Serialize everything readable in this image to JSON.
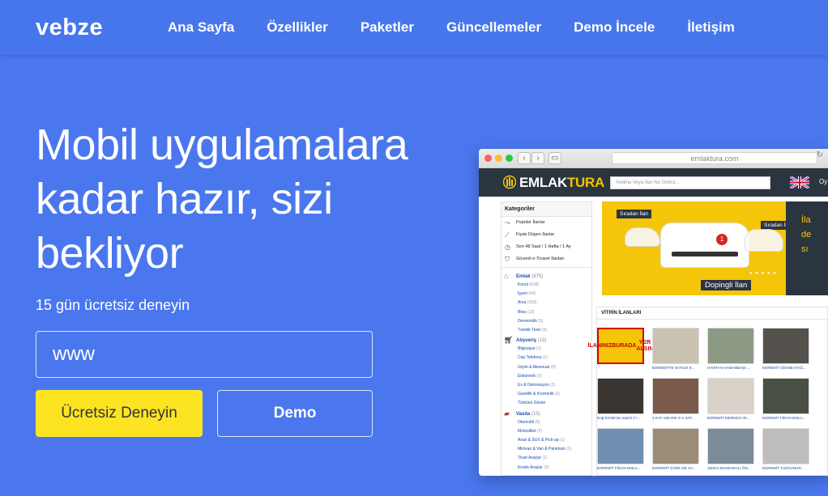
{
  "header": {
    "logo": "vebze",
    "nav": [
      "Ana Sayfa",
      "Özellikler",
      "Paketler",
      "Güncellemeler",
      "Demo İncele",
      "İletişim"
    ]
  },
  "hero": {
    "title": "Mobil uygulamalara kadar hazır, sizi bekliyor",
    "subtitle": "15 gün ücretsiz deneyin",
    "domain_placeholder": "www",
    "trial_button": "Ücretsiz Deneyin",
    "demo_button": "Demo"
  },
  "browser": {
    "url": "emlaktura.com",
    "site": {
      "logo_prefix": "EMLAK",
      "logo_accent": "TURA",
      "search_placeholder": "Kelime Veya İlan No Giriniz...",
      "lang": "Oy"
    },
    "sidebar": {
      "title": "Kategoriler",
      "quick": [
        "Popüler İlanlar",
        "Fiyatı Düşen İlanlar",
        "Son 48 Saat  / 1 Hafta / 1 Ay",
        "Güvenli e-Ticaret İlanları"
      ],
      "categories": [
        {
          "name": "Emlak",
          "count": "(975)",
          "items": [
            {
              "name": "Konut",
              "count": "(638)"
            },
            {
              "name": "İşyeri",
              "count": "(64)"
            },
            {
              "name": "Arsa",
              "count": "(250)"
            },
            {
              "name": "Bina",
              "count": "(13)"
            },
            {
              "name": "Devremülk",
              "count": "(5)"
            },
            {
              "name": "Turistik Tesis",
              "count": "(5)"
            }
          ]
        },
        {
          "name": "Alışveriş",
          "count": "(13)",
          "items": [
            {
              "name": "Bilgisayar",
              "count": "(1)"
            },
            {
              "name": "Cep Telefonu",
              "count": "(1)"
            },
            {
              "name": "Giyim & Aksesuar",
              "count": "(0)"
            },
            {
              "name": "Elektronik",
              "count": "(2)"
            },
            {
              "name": "Ev & Dekorasyon",
              "count": "(2)"
            },
            {
              "name": "Güzellik & Kozmetik",
              "count": "(0)"
            },
            {
              "name": "Tümünü Göster",
              "count": ""
            }
          ]
        },
        {
          "name": "Vasıta",
          "count": "(15)",
          "items": [
            {
              "name": "Otomobil",
              "count": "(8)"
            },
            {
              "name": "Motosiklet",
              "count": "(2)"
            },
            {
              "name": "Arazi & SUV & Pick-up",
              "count": "(1)"
            },
            {
              "name": "Minivan & Van & Panelvan",
              "count": "(2)"
            },
            {
              "name": "Ticari Araçlar",
              "count": "(1)"
            },
            {
              "name": "Kiralık Araçlar",
              "count": "(0)"
            }
          ]
        }
      ]
    },
    "banner": {
      "tag_left": "Sıradan İlan",
      "tag_right": "Sıradan İlan",
      "doping": "Dopingli İlan",
      "side_text": [
        "İla",
        "de",
        "sı"
      ]
    },
    "vitrin": {
      "title": "VİTRİN İLANLARI",
      "ad_text": [
        "İLANINIZ",
        "BURADA",
        "YER ALSIN"
      ],
      "captions": [
        "",
        "EDREMİTTE SATILIK 9...",
        "HAVRAN HAMAMBAŞI ...",
        "EDREMİT CENNEAYAĞ...",
        "Doğ Emlak'tan satılık 2+...",
        "3 KAT 195.000 3+1 SAT...",
        "EDREMİT MERKEZ HE...",
        "EDREMİT FİDAN EMLA...",
        "EDREMİT FİDAN EMLA...",
        "EDREMİT GÜRE DE SA...",
        "150m2 MANZARALI ÖN...",
        "EDREMİT TUZCUMUR..."
      ],
      "thumb_colors": [
        "#f5c50a",
        "#c9c2b0",
        "#8c9a86",
        "#55514c",
        "#3a3530",
        "#7a5a4a",
        "#d8d2c8",
        "#4a4f45",
        "#6f8fb0",
        "#9b8c78",
        "#7d8a98",
        "#bdbdbd"
      ]
    }
  }
}
